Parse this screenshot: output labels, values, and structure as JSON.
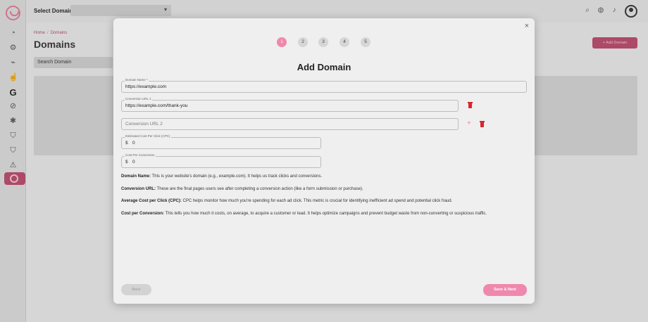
{
  "topbar": {
    "select_domain_label": "Select Domain",
    "icons": [
      "search-icon",
      "globe-icon",
      "bell-icon",
      "user-avatar-icon"
    ]
  },
  "sidebar": {
    "icons": [
      "logo-icon",
      "rocket-icon",
      "gear-icon",
      "link-icon",
      "click-icon",
      "google-icon",
      "block-icon",
      "bug-icon",
      "shield-check-icon",
      "shield-icon",
      "warning-icon",
      "smile-icon"
    ],
    "google_glyph": "G"
  },
  "page": {
    "breadcrumb_home": "Home",
    "breadcrumb_sep": "/",
    "breadcrumb_current": "Domains",
    "title": "Domains",
    "search_placeholder": "Search Domain",
    "add_button": "Add Domain"
  },
  "modal": {
    "title": "Add Domain",
    "steps": [
      "1",
      "2",
      "3",
      "4",
      "5"
    ],
    "active_step": "1",
    "close_glyph": "×",
    "fields": {
      "domain_name_label": "Domain Name *",
      "domain_name_value": "https://example.com",
      "conversion_url_1_label": "Conversion URL 1",
      "conversion_url_1_value": "https://example.com/thank-you",
      "conversion_url_2_placeholder": "Conversion URL 2",
      "cpc_label": "Estimated Cost Per Click (CPC)",
      "cpc_currency": "$",
      "cpc_value": "0",
      "cpa_label": "Cost Per Conversion",
      "cpa_currency": "$",
      "cpa_value": "0"
    },
    "descriptions": [
      {
        "term": "Domain Name:",
        "text": " This is your website's domain (e.g., example.com). It helps us track clicks and conversions."
      },
      {
        "term": "Conversion URL:",
        "text": " These are the final pages users see after completing a conversion action (like a form submission or purchase)."
      },
      {
        "term": "Average Cost per Click (CPC):",
        "text": " CPC helps monitor how much you're spending for each ad click. This metric is crucial for identifying inefficient ad spend and potential click fraud."
      },
      {
        "term": "Cost per Conversion:",
        "text": " This tells you how much it costs, on average, to acquire a customer or lead. It helps optimize campaigns and prevent budget waste from non-converting or suspicious traffic."
      }
    ],
    "back_button": "Back",
    "next_button": "Save & Next"
  },
  "colors": {
    "accent": "#f088ad",
    "brand": "#b9496a",
    "danger": "#d8262c"
  }
}
